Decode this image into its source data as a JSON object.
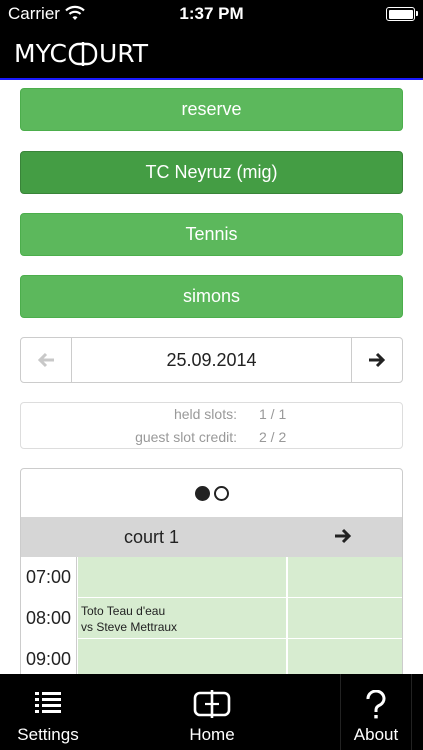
{
  "status_bar": {
    "carrier": "Carrier",
    "time": "1:37 PM"
  },
  "nav_bar": {
    "logo_left": "MYC",
    "logo_right": "URT"
  },
  "selectors": {
    "reserve": "reserve",
    "club": "TC Neyruz (mig)",
    "sport": "Tennis",
    "user": "simons"
  },
  "date_nav": {
    "date": "25.09.2014"
  },
  "slots_info": {
    "held_label": "held slots:",
    "held_value": "1 / 1",
    "guest_label": "guest slot credit:",
    "guest_value": "2 / 2"
  },
  "court_panel": {
    "court_name": "court 1",
    "rows": [
      {
        "time": "07:00",
        "booking_line1": "",
        "booking_line2": ""
      },
      {
        "time": "08:00",
        "booking_line1": "Toto Teau d'eau",
        "booking_line2": "vs Steve Mettraux"
      },
      {
        "time": "09:00",
        "booking_line1": "",
        "booking_line2": ""
      }
    ]
  },
  "tab_bar": {
    "settings": "Settings",
    "home": "Home",
    "about": "About"
  },
  "colors": {
    "button_green": "#5cb85c",
    "button_green_active": "#449d44",
    "slot_green": "#d7ecd0",
    "header_gray": "#d6d6d6",
    "bar_black": "#000000"
  },
  "icons": [
    "wifi-icon",
    "battery-icon",
    "arrow-left-icon",
    "arrow-right-icon",
    "list-icon",
    "court-icon",
    "question-icon"
  ]
}
